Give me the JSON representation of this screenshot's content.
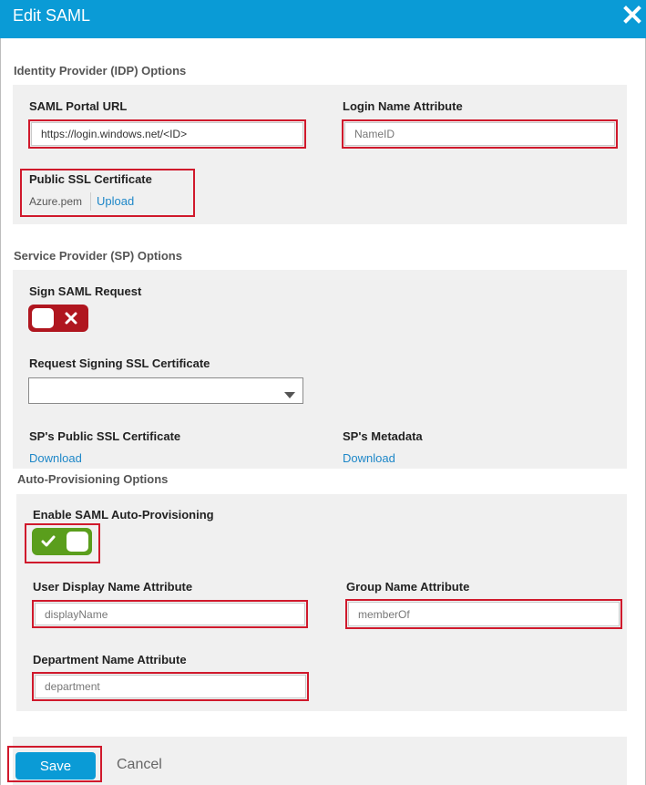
{
  "dialog": {
    "title": "Edit SAML",
    "close_icon": "close-icon"
  },
  "idp": {
    "section_title": "Identity Provider (IDP) Options",
    "saml_portal_url_label": "SAML Portal URL",
    "saml_portal_url_value": "https://login.windows.net/<ID>",
    "login_name_attr_label": "Login Name Attribute",
    "login_name_attr_value": "NameID",
    "public_ssl_label": "Public SSL Certificate",
    "public_ssl_file": "Azure.pem",
    "upload_link": "Upload"
  },
  "sp": {
    "section_title": "Service Provider (SP) Options",
    "sign_saml_label": "Sign SAML Request",
    "sign_saml_state": "off",
    "request_signing_label": "Request Signing SSL Certificate",
    "request_signing_value": "",
    "sp_public_ssl_label": "SP's Public SSL Certificate",
    "sp_public_download": "Download",
    "sp_metadata_label": "SP's Metadata",
    "sp_metadata_download": "Download"
  },
  "auto": {
    "section_title": "Auto-Provisioning Options",
    "enable_label": "Enable SAML Auto-Provisioning",
    "enable_state": "on",
    "user_display_label": "User Display Name Attribute",
    "user_display_value": "displayName",
    "group_name_label": "Group Name Attribute",
    "group_name_value": "memberOf",
    "department_label": "Department Name Attribute",
    "department_value": "department"
  },
  "footer": {
    "save_label": "Save",
    "cancel_label": "Cancel"
  },
  "colors": {
    "title_bar": "#0a9bd6",
    "highlight": "#d0192c",
    "toggle_off": "#b0161f",
    "toggle_on": "#5a9e1c",
    "link": "#1e87c8"
  }
}
